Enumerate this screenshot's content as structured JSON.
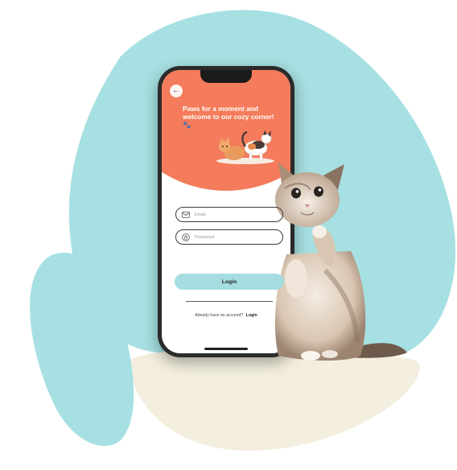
{
  "hero": {
    "title": "Paws for a moment and welcome to our cozy corner! 🐾"
  },
  "form": {
    "email_placeholder": "Email",
    "password_placeholder": "Password",
    "login_label": "Login"
  },
  "footer": {
    "question": "Already have an account?",
    "link_label": "Login"
  },
  "icons": {
    "back": "arrow-left-icon",
    "email": "mail-icon",
    "password": "lock-icon"
  },
  "colors": {
    "hero_coral": "#f47b5b",
    "accent_teal": "#a5dde0",
    "blob_teal": "#a6e0e2",
    "blob_cream": "#f3eedd"
  }
}
